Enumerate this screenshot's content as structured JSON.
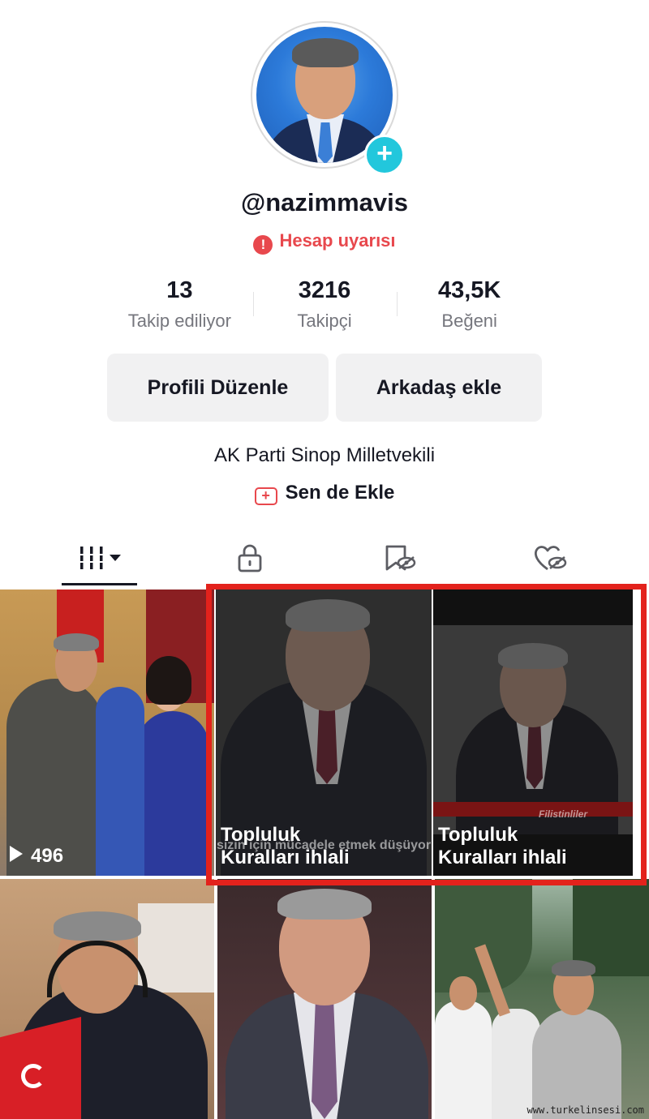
{
  "profile": {
    "username": "@nazimmavis",
    "warning": "Hesap uyarısı",
    "warning_icon": "exclamation-icon",
    "bio": "AK Parti Sinop Milletvekili",
    "add_link": "Sen de Ekle"
  },
  "stats": [
    {
      "value": "13",
      "label": "Takip ediliyor"
    },
    {
      "value": "3216",
      "label": "Takipçi"
    },
    {
      "value": "43,5K",
      "label": "Beğeni"
    }
  ],
  "buttons": {
    "edit": "Profili Düzenle",
    "add_friend": "Arkadaş ekle"
  },
  "tabs": [
    {
      "name": "videos",
      "icon": "grid-icon",
      "active": true
    },
    {
      "name": "private",
      "icon": "lock-icon"
    },
    {
      "name": "reposts",
      "icon": "hidden-favorites-icon"
    },
    {
      "name": "liked",
      "icon": "hidden-heart-icon"
    }
  ],
  "videos": [
    {
      "views": "496"
    },
    {
      "violation": "Topluluk Kuralları ihlali",
      "caption": "sizin için mücadele etmek düşüyor"
    },
    {
      "violation": "Topluluk Kuralları ihlali",
      "caption": "Filistinliler"
    },
    {},
    {},
    {}
  ],
  "watermark": "www.turkelinsesi.com",
  "colors": {
    "accent_red": "#e8484d",
    "plus_cyan": "#22c7dc",
    "highlight": "#e3221c",
    "button_bg": "#f1f1f2"
  }
}
